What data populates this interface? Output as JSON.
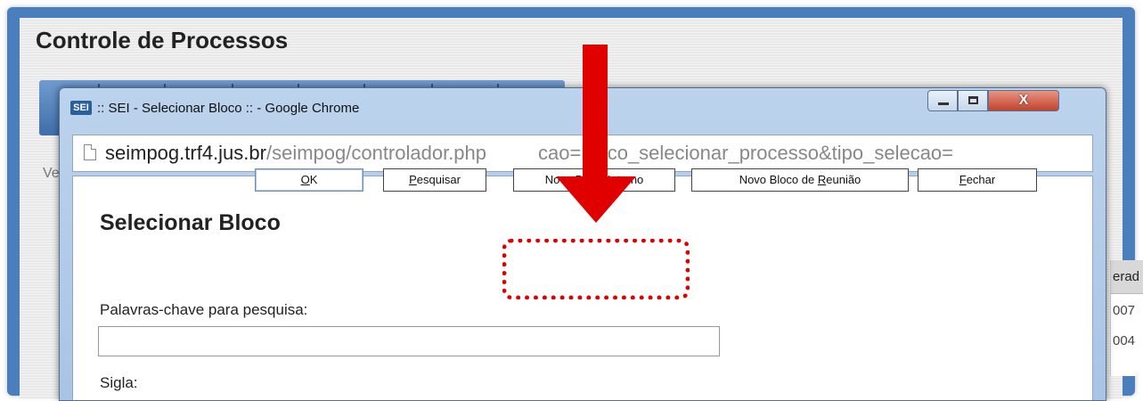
{
  "background_page": {
    "title": "Controle de Processos",
    "partial_label": "Ve",
    "table": {
      "column_header": "erad",
      "cells": [
        "007",
        "004"
      ]
    }
  },
  "popup": {
    "favicon": "SEI",
    "window_title": ":: SEI - Selecionar Bloco :: - Google Chrome",
    "url_domain": "seimpog.trf4.jus.br",
    "url_path_before": "/seimpog/controlador.php",
    "url_path_after": "cao=bloco_selecionar_processo&tipo_selecao=",
    "window_controls": {
      "minimize_icon": "minimize-icon",
      "maximize_icon": "maximize-icon",
      "close_icon": "close-icon",
      "close_glyph": "X"
    }
  },
  "dialog": {
    "title": "Selecionar Bloco",
    "buttons": {
      "ok": {
        "pre": "",
        "accel": "O",
        "post": "K"
      },
      "pesquisar": {
        "pre": "",
        "accel": "P",
        "post": "esquisar"
      },
      "novo_interno": {
        "pre": "Novo Bloco ",
        "accel": "I",
        "post": "nterno"
      },
      "novo_reuniao": {
        "pre": "Novo Bloco de ",
        "accel": "R",
        "post": "eunião"
      },
      "fechar": {
        "pre": "",
        "accel": "F",
        "post": "echar"
      }
    },
    "palavras_label": "Palavras-chave para pesquisa:",
    "palavras_value": "",
    "sigla_label": "Sigla:"
  },
  "annotation": {
    "arrow_color": "#e10000",
    "highlight_color": "#e10000"
  }
}
